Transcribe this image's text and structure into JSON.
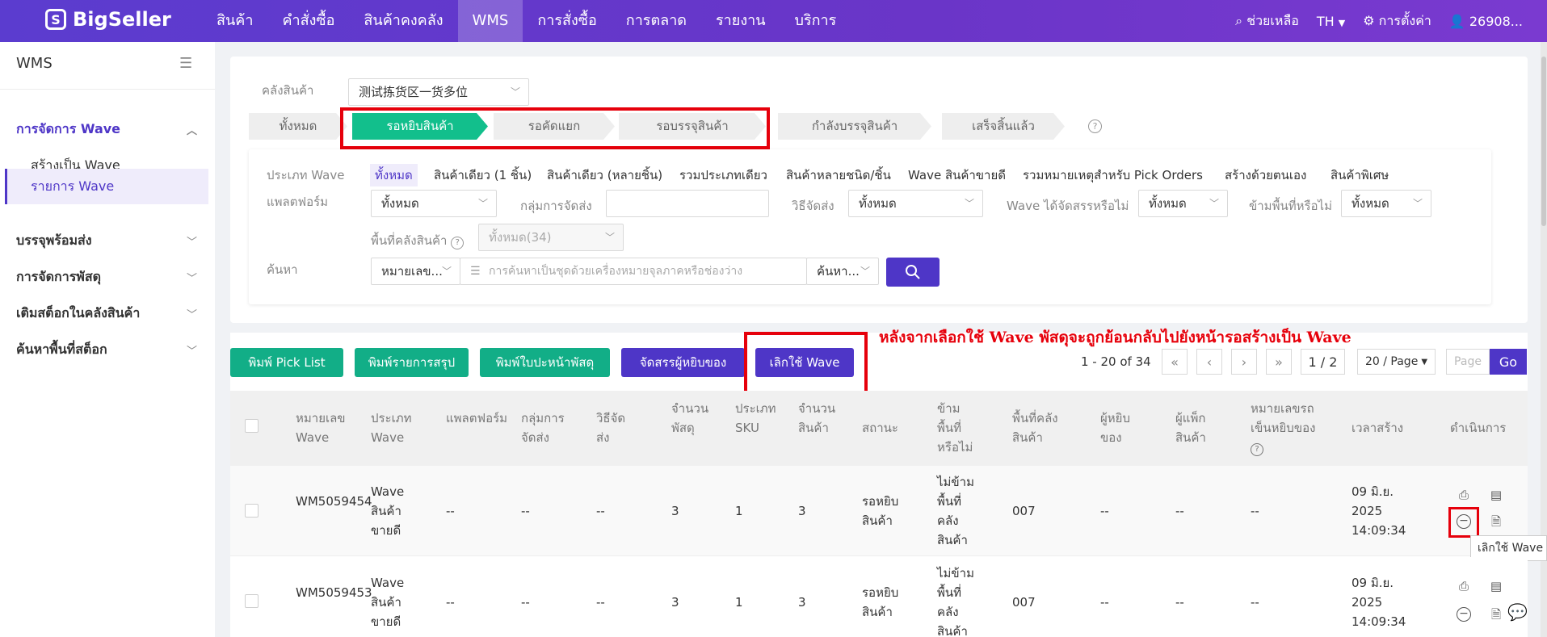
{
  "top": {
    "brand": "BigSeller",
    "nav": [
      "สินค้า",
      "คำสั่งซื้อ",
      "สินค้าคงคลัง",
      "WMS",
      "การสั่งซื้อ",
      "การตลาด",
      "รายงาน",
      "บริการ"
    ],
    "active_nav": "WMS",
    "help": "ช่วยเหลือ",
    "lang": "TH",
    "settings": "การตั้งค่า",
    "user": "26908..."
  },
  "sidebar": {
    "title": "WMS",
    "items": [
      {
        "label": "การจัดการ Wave",
        "type": "group-open"
      },
      {
        "label": "สร้างเป็น Wave",
        "type": "sub"
      },
      {
        "label": "รายการ Wave",
        "type": "sub-selected"
      },
      {
        "label": "บรรจุพร้อมส่ง",
        "type": "group"
      },
      {
        "label": "การจัดการพัสดุ",
        "type": "group"
      },
      {
        "label": "เติมสต็อกในคลังสินค้า",
        "type": "group"
      },
      {
        "label": "ค้นหาพื้นที่สต็อก",
        "type": "group"
      }
    ]
  },
  "filters": {
    "warehouse_label": "คลังสินค้า",
    "warehouse_value": "测试拣货区一货多位",
    "steps": [
      "ทั้งหมด",
      "รอหยิบสินค้า",
      "รอคัดแยก",
      "รอบรรจุสินค้า",
      "กำลังบรรจุสินค้า",
      "เสร็จสิ้นแล้ว"
    ],
    "active_step": "รอหยิบสินค้า",
    "wave_type_label": "ประเภท Wave",
    "wave_types": [
      "ทั้งหมด",
      "สินค้าเดียว (1 ชิ้น)",
      "สินค้าเดียว (หลายชิ้น)",
      "รวมประเภทเดียว",
      "สินค้าหลายชนิด/ชิ้น",
      "Wave สินค้าขายดี",
      "รวมหมายเหตุสำหรับ Pick Orders",
      "สร้างด้วยตนเอง",
      "สินค้าพิเศษ"
    ],
    "platform_label": "แพลตฟอร์ม",
    "platform_value": "ทั้งหมด",
    "shipping_group_label": "กลุ่มการจัดส่ง",
    "shipping_group_value": "",
    "shipping_method_label": "วิธีจัดส่ง",
    "shipping_method_value": "ทั้งหมด",
    "picker_assigned_label": "Wave ได้จัดสรรหรือไม่",
    "picker_assigned_value": "ทั้งหมด",
    "skip_area_label": "ข้ามพื้นที่หรือไม่",
    "skip_area_value": "ทั้งหมด",
    "area_label": "พื้นที่คลังสินค้า",
    "area_value": "ทั้งหมด(34)",
    "search_label": "ค้นหา",
    "search_field": "หมายเลข...",
    "search_placeholder": "การค้นหาเป็นชุดด้วยเครื่องหมายจุลภาคหรือช่องว่าง",
    "search_mode": "ค้นหา..."
  },
  "actions": {
    "buttons": [
      "พิมพ์ Pick List",
      "พิมพ์รายการสรุป",
      "พิมพ์ใบปะหน้าพัสดุ",
      "จัดสรรผู้หยิบของ",
      "เลิกใช้ Wave"
    ],
    "annotation": "หลังจากเลือกใช้ Wave พัสดุจะถูกย้อนกลับไปยังหน้ารอสร้างเป็น Wave"
  },
  "pagination": {
    "range": "1 - 20 of 34",
    "page": "1 / 2",
    "page_size": "20 / Page",
    "page_placeholder": "Page",
    "go": "Go"
  },
  "table": {
    "headers": [
      "หมายเลข Wave",
      "ประเภท Wave",
      "แพลตฟอร์ม",
      "กลุ่มการจัดส่ง",
      "วิธีจัดส่ง",
      "จำนวนพัสดุ",
      "ประเภท SKU",
      "จำนวนสินค้า",
      "สถานะ",
      "ข้ามพื้นที่หรือไม่",
      "พื้นที่คลังสินค้า",
      "ผู้หยิบของ",
      "ผู้แพ็กสินค้า",
      "หมายเลขรถเข็นหยิบของ",
      "เวลาสร้าง",
      "ดำเนินการ"
    ],
    "rows": [
      {
        "wave_no": "WM5059454",
        "type": "Wave สินค้าขายดี",
        "platform": "--",
        "group": "--",
        "method": "--",
        "parcels": "3",
        "sku_types": "1",
        "qty": "3",
        "status": "รอหยิบสินค้า",
        "skip": "ไม่ข้ามพื้นที่คลังสินค้า",
        "area": "007",
        "picker": "--",
        "packer": "--",
        "cart": "--",
        "created": "09 มิ.ย. 2025 14:09:34"
      },
      {
        "wave_no": "WM5059453",
        "type": "Wave สินค้าขายดี",
        "platform": "--",
        "group": "--",
        "method": "--",
        "parcels": "3",
        "sku_types": "1",
        "qty": "3",
        "status": "รอหยิบสินค้า",
        "skip": "ไม่ข้ามพื้นที่คลังสินค้า",
        "area": "007",
        "picker": "--",
        "packer": "--",
        "cart": "--",
        "created": "09 มิ.ย. 2025 14:09:34"
      }
    ],
    "tooltip": "เลิกใช้ Wave"
  },
  "colors": {
    "brand": "#5b3ccf",
    "active_step": "#12bf8c",
    "highlight": "#e6000b",
    "button_green": "#12ae87",
    "button_purple": "#4e36c7"
  }
}
